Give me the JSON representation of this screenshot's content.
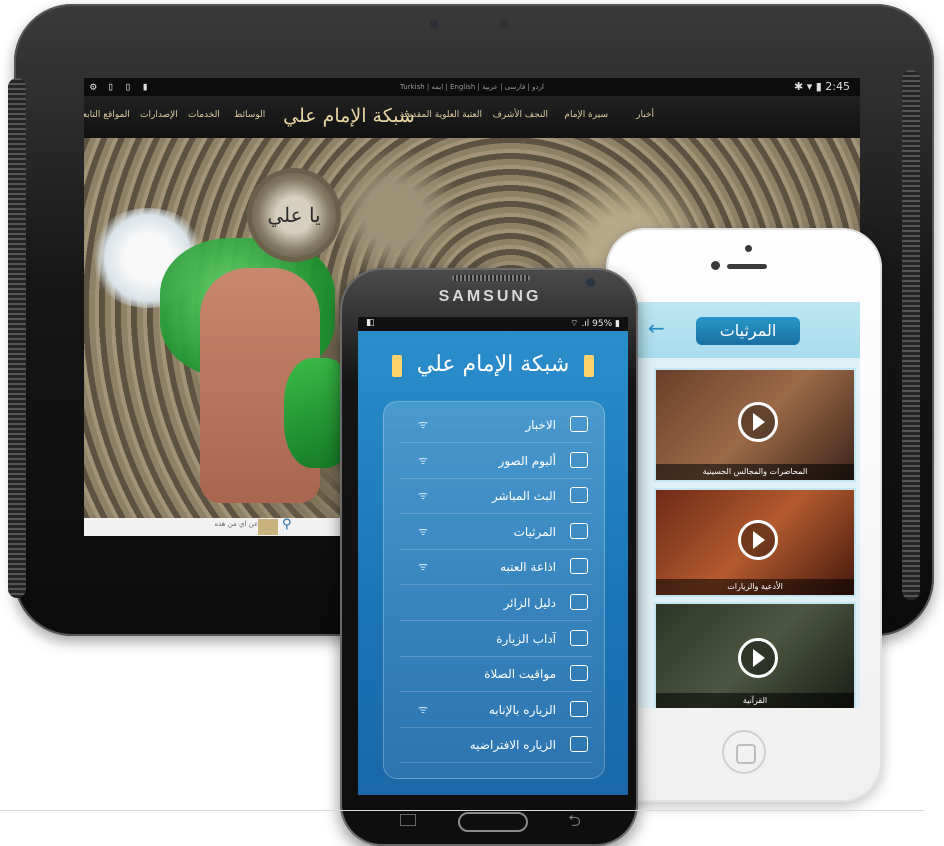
{
  "tablet": {
    "status_left": "⚙ ▯ ▯ ▮",
    "status_right": "✱ ▾ ▮ 2:45",
    "language_bar": "Turkish | ایمه | English | اردو | فارسی | عربية",
    "logo_text": "شبكة الإمام علي",
    "nav_items": [
      "أخبار",
      "سيرة الإمام",
      "النجف الأشرف",
      "العتبة العلوية المقدسة",
      "الوسائط",
      "الخدمات",
      "الإصدارات",
      "المواقع التابعة"
    ],
    "medallion_text": "يا علي",
    "search_placeholder": "البحث عن اي من هذه"
  },
  "iphone": {
    "back_arrow": "←",
    "title": "المرثيات",
    "cards": [
      {
        "caption": "المحاضرات والمجالس الحسينية"
      },
      {
        "caption": "الأدعية والزيارات"
      },
      {
        "caption": "القرآنية"
      }
    ]
  },
  "samsung": {
    "brand": "SAMSUNG",
    "status_left": "◧",
    "status_right": "⌔ .ıl 95% ▮",
    "logo_text": "شبكة الإمام علي",
    "wifi_glyph": "ᯤ",
    "back_glyph": "⮌",
    "menu": [
      {
        "label": "الاخبار",
        "icon": "news-icon",
        "wifi": true
      },
      {
        "label": "ألبوم الصور",
        "icon": "photo-album-icon",
        "wifi": true
      },
      {
        "label": "البث المباشر",
        "icon": "live-tv-icon",
        "wifi": true
      },
      {
        "label": "المرثيات",
        "icon": "video-icon",
        "wifi": true
      },
      {
        "label": "اذاعة العتبه",
        "icon": "radio-icon",
        "wifi": true
      },
      {
        "label": "دليل الزائر",
        "icon": "map-pin-icon",
        "wifi": false
      },
      {
        "label": "آداب الزيارة",
        "icon": "book-icon",
        "wifi": false
      },
      {
        "label": "مواقيت الصلاة",
        "icon": "bell-icon",
        "wifi": false
      },
      {
        "label": "الزياره بالإنابه",
        "icon": "dome-icon",
        "wifi": true
      },
      {
        "label": "الزياره الافتراضيه",
        "icon": "virtual-visit-icon",
        "wifi": false
      }
    ]
  },
  "colors": {
    "samsung_screen": "#1c74b6",
    "iphone_title_bg": "#1b6fa3",
    "tablet_nav_text": "#d9c9a0"
  }
}
